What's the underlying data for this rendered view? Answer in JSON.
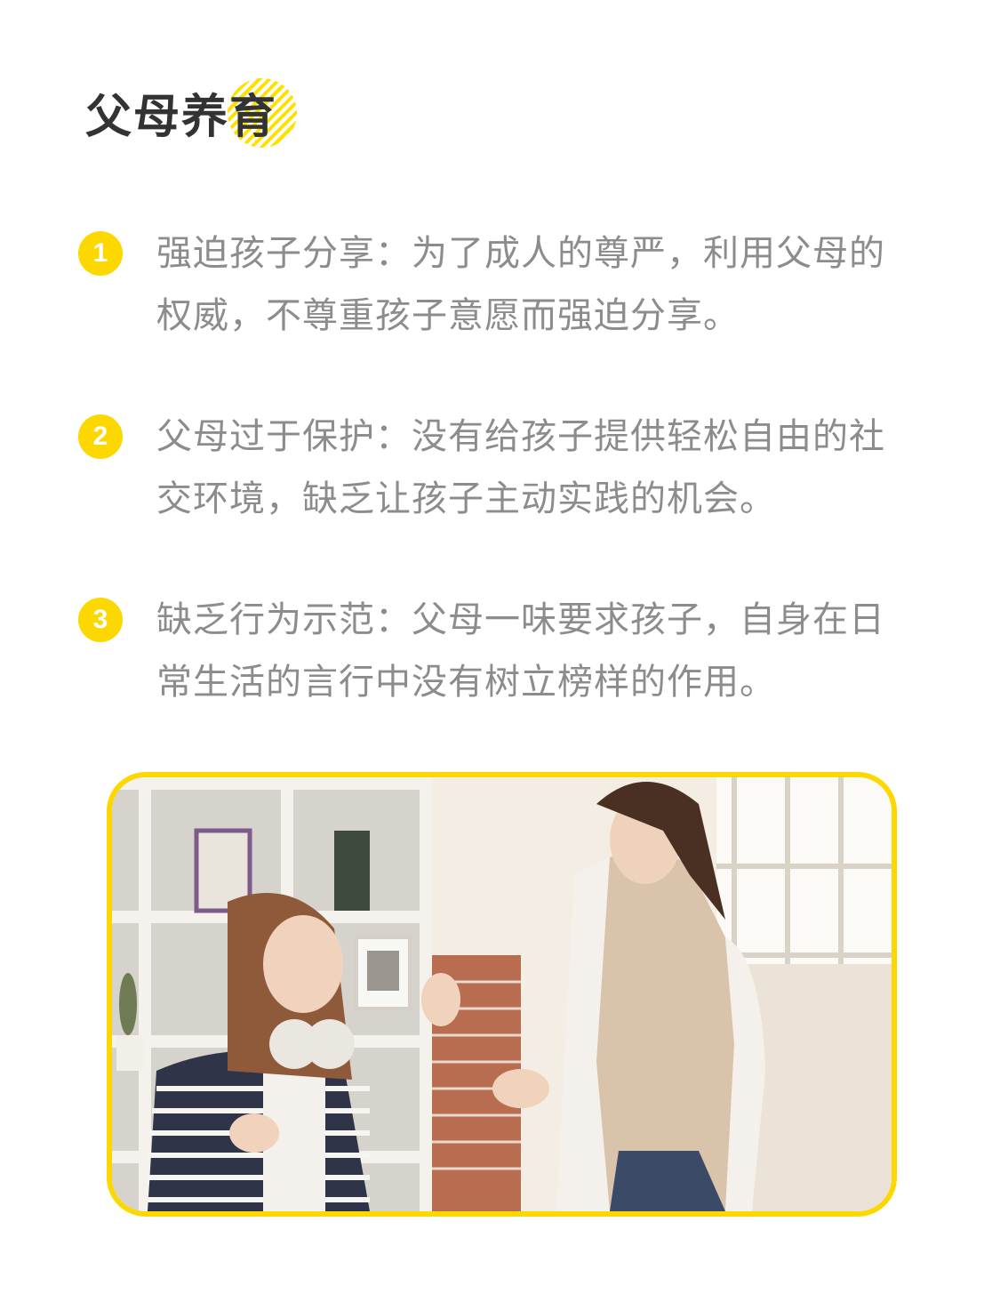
{
  "section": {
    "title": "父母养育"
  },
  "items": [
    {
      "number": "1",
      "text": "强迫孩子分享：为了成人的尊严，利用父母的权威，不尊重孩子意愿而强迫分享。"
    },
    {
      "number": "2",
      "text": "父母过于保护：没有给孩子提供轻松自由的社交环境，缺乏让孩子主动实践的机会。"
    },
    {
      "number": "3",
      "text": "缺乏行为示范：父母一味要求孩子，自身在日常生活的言行中没有树立榜样的作用。"
    }
  ],
  "colors": {
    "accent": "#fcd800",
    "title": "#333333",
    "body_text": "#8c8c8c"
  }
}
